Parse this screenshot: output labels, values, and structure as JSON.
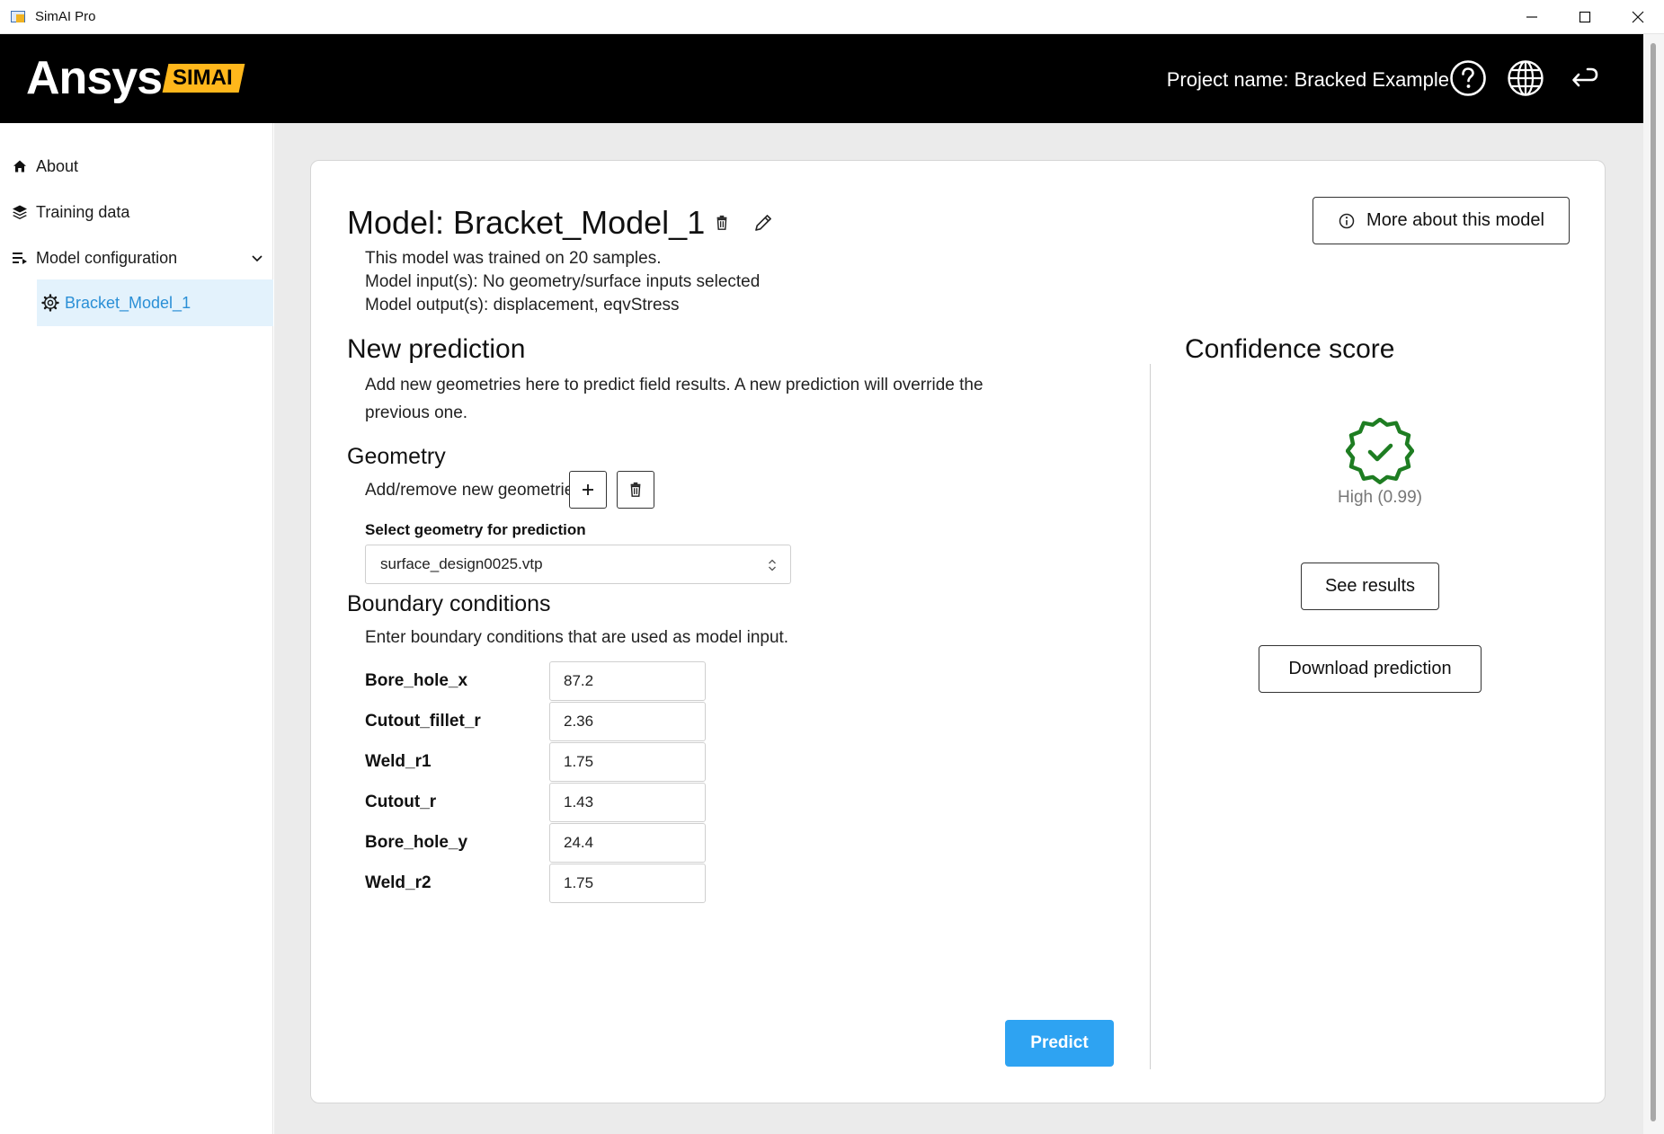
{
  "window": {
    "title": "SimAI Pro"
  },
  "header": {
    "logo_ansys": "Ansys",
    "logo_simai": "SIMAI",
    "project_name": "Project name: Bracked Example",
    "icons": [
      "help-icon",
      "globe-icon",
      "return-icon"
    ]
  },
  "sidebar": {
    "items": [
      {
        "label": "About",
        "icon": "home-icon"
      },
      {
        "label": "Training data",
        "icon": "layers-icon"
      },
      {
        "label": "Model configuration",
        "icon": "list-config-icon"
      }
    ],
    "sub_item": {
      "label": "Bracket_Model_1",
      "icon": "gear-icon",
      "color": "#2a8fd6"
    }
  },
  "model": {
    "title": "Model: Bracket_Model_1",
    "more_button": "More about this model",
    "info": [
      "This model was trained on 20 samples.",
      "Model input(s): No geometry/surface inputs selected",
      "Model output(s): displacement, eqvStress"
    ]
  },
  "prediction": {
    "heading": "New prediction",
    "description": "Add new geometries here to predict field results. A new prediction will override the previous one.",
    "geometry_heading": "Geometry",
    "add_remove_label": "Add/remove new geometries",
    "select_label": "Select geometry for prediction",
    "selected_geometry": "surface_design0025.vtp",
    "bc_heading": "Boundary conditions",
    "bc_description": "Enter boundary conditions that are used as model input.",
    "boundary_conditions": [
      {
        "name": "Bore_hole_x",
        "value": "87.2"
      },
      {
        "name": "Cutout_fillet_r",
        "value": "2.36"
      },
      {
        "name": "Weld_r1",
        "value": "1.75"
      },
      {
        "name": "Cutout_r",
        "value": "1.43"
      },
      {
        "name": "Bore_hole_y",
        "value": "24.4"
      },
      {
        "name": "Weld_r2",
        "value": "1.75"
      }
    ],
    "predict_button": "Predict",
    "predict_color": "#2ea3f2"
  },
  "confidence": {
    "heading": "Confidence score",
    "level": "High (0.99)",
    "badge_color": "#1e7d22",
    "see_results": "See results",
    "download": "Download prediction"
  }
}
